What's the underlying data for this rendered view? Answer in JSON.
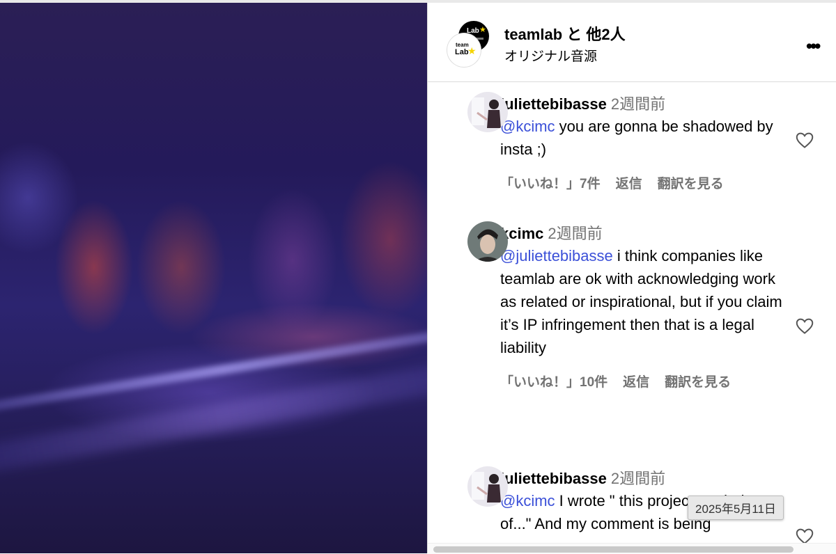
{
  "header": {
    "owner": "teamlab と 他2人",
    "audio": "オリジナル音源",
    "more_label": "•••",
    "logo_text": "team Lab"
  },
  "comments": [
    {
      "username": "juliettebibasse",
      "time": "2週間前",
      "mention": "@kcimc",
      "text": " you are gonna be shadowed by insta ;)",
      "likes": "「いいね！」7件",
      "reply": "返信",
      "translate": "翻訳を見る"
    },
    {
      "username": "kcimc",
      "time": "2週間前",
      "mention": "@juliettebibasse",
      "text": " i think companies like teamlab are ok with acknowledging work as related or inspirational, but if you claim it’s IP infringement then that is a legal liability",
      "likes": "「いいね！」10件",
      "reply": "返信",
      "translate": "翻訳を見る"
    },
    {
      "username": "juliettebibasse",
      "time": "2週間前",
      "mention": "@kcimc",
      "text": " I wrote \" this project reminds me of...\" And my comment is being"
    }
  ],
  "tooltip": "2025年5月11日",
  "icons": {
    "heart": "heart-icon",
    "more": "more-icon"
  },
  "colors": {
    "mention": "#3b50d8",
    "meta": "#737373"
  }
}
